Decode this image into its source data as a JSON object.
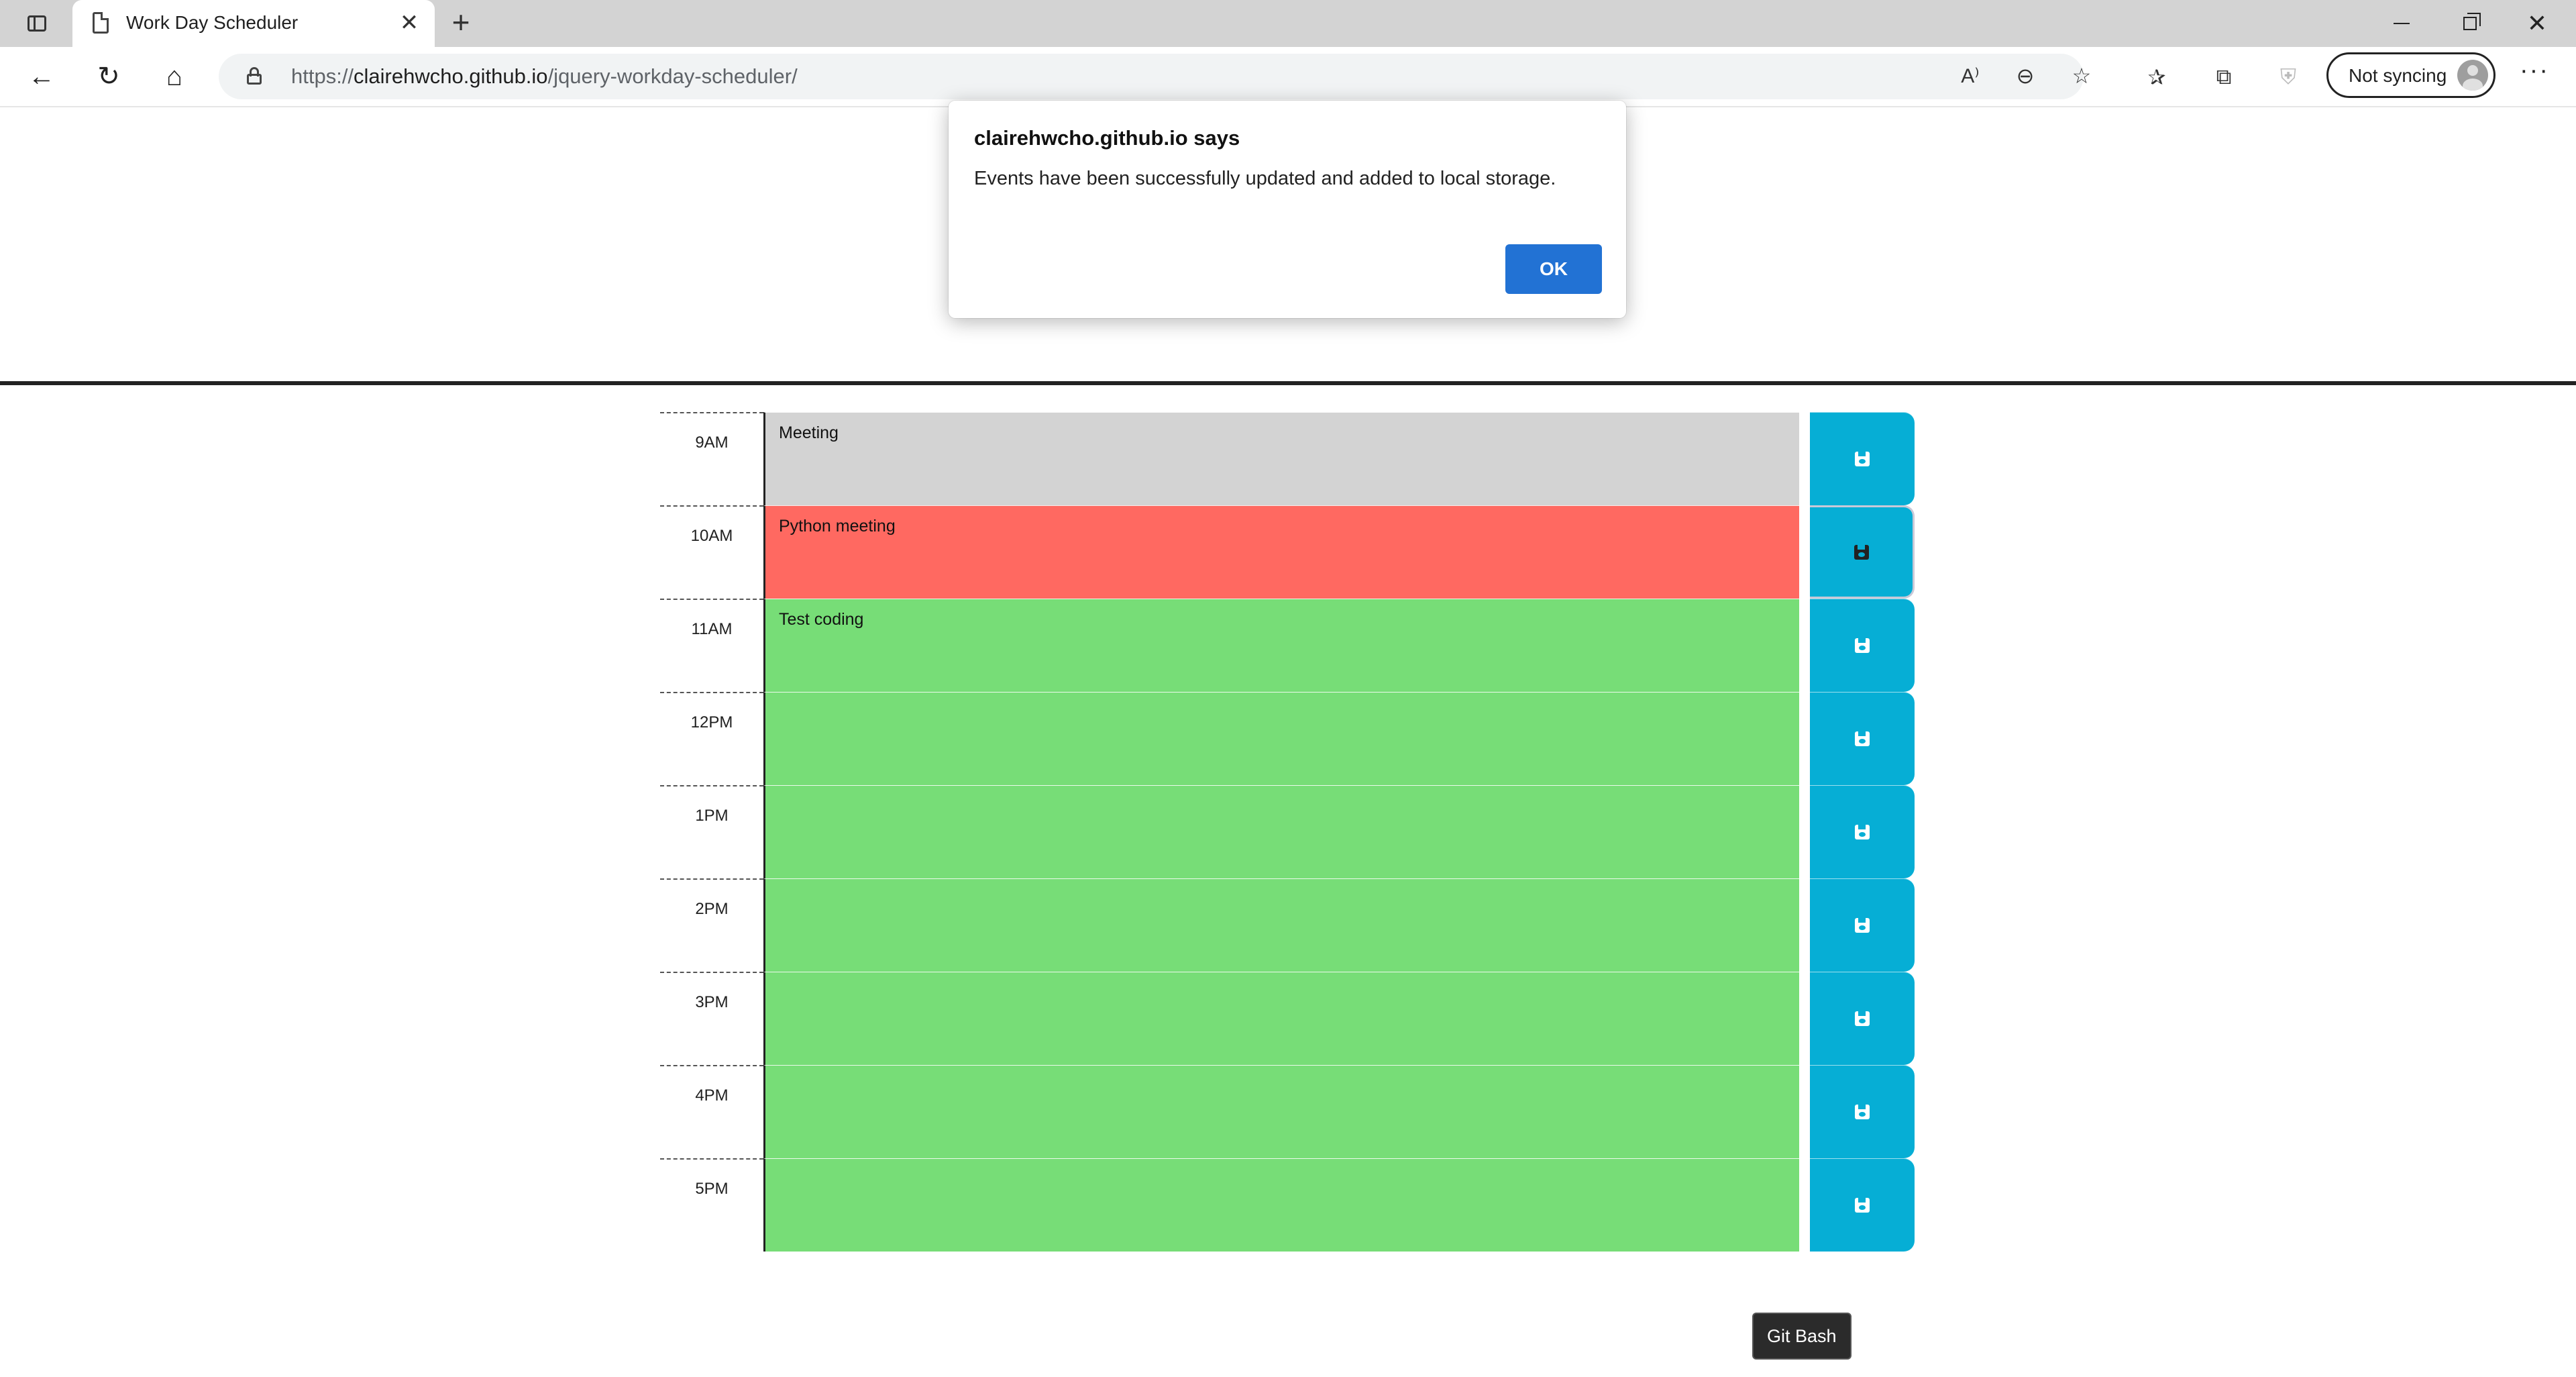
{
  "browser": {
    "tab": {
      "title": "Work Day Scheduler",
      "close_glyph": "✕"
    },
    "new_tab_glyph": "+",
    "window": {
      "minimize": "minimize-icon",
      "restore": "restore-icon",
      "close_glyph": "✕"
    },
    "url": {
      "prefix": "https://",
      "host": "clairehwcho.github.io",
      "path": "/jquery-workday-scheduler/"
    },
    "sync_label": "Not syncing",
    "more_glyph": "···",
    "icons": {
      "back": "←",
      "refresh": "↻",
      "home": "⌂",
      "read_aloud": "A⁾",
      "zoom": "⊖",
      "add_favorite": "☆",
      "favorites": "✰",
      "collections": "⧉",
      "shield": "⛨"
    }
  },
  "dialog": {
    "title": "clairehwcho.github.io says",
    "message": "Events have been successfully updated and added to local storage.",
    "ok_label": "OK"
  },
  "scheduler": {
    "colors": {
      "past": "#d3d3d3",
      "present": "#ff6961",
      "future": "#77dd77",
      "save": "#06aed5"
    },
    "rows": [
      {
        "hour": "9AM",
        "text": "Meeting",
        "state": "past"
      },
      {
        "hour": "10AM",
        "text": "Python meeting",
        "state": "present"
      },
      {
        "hour": "11AM",
        "text": "Test coding",
        "state": "future"
      },
      {
        "hour": "12PM",
        "text": "",
        "state": "future"
      },
      {
        "hour": "1PM",
        "text": "",
        "state": "future"
      },
      {
        "hour": "2PM",
        "text": "",
        "state": "future"
      },
      {
        "hour": "3PM",
        "text": "",
        "state": "future"
      },
      {
        "hour": "4PM",
        "text": "",
        "state": "future"
      },
      {
        "hour": "5PM",
        "text": "",
        "state": "future"
      }
    ]
  },
  "tooltip": {
    "text": "Git Bash"
  }
}
